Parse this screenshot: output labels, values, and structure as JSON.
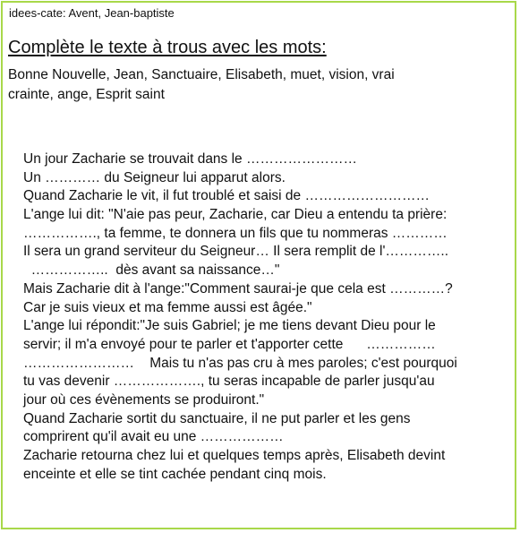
{
  "header": {
    "label": "idees-cate: Avent, Jean-baptiste"
  },
  "exercise": {
    "title": "Complète le texte à trous avec les mots:",
    "wordbank_line1": "Bonne Nouvelle,  Jean,  Sanctuaire,  Elisabeth,  muet,  vision,  vrai",
    "wordbank_line2": "crainte,  ange,  Esprit saint"
  },
  "story": {
    "lines": [
      "Un jour Zacharie se trouvait dans le ……………………",
      "Un ………… du Seigneur lui apparut alors.",
      "Quand Zacharie le vit, il fut troublé et saisi de ………………………",
      "L'ange lui dit: \"N'aie pas peur, Zacharie, car Dieu a entendu ta prière:",
      "……………., ta femme, te donnera un fils que tu nommeras …………",
      "Il sera un grand serviteur du Seigneur… Il sera remplit de l'…………..",
      "  ……………..  dès avant sa naissance…\"",
      "Mais Zacharie dit à l'ange:\"Comment saurai-je que cela est …………?",
      "Car je suis vieux et ma femme aussi est âgée.\"",
      "L'ange lui répondit:\"Je suis Gabriel; je me tiens devant Dieu pour le",
      "servir; il m'a envoyé pour te parler et t'apporter cette      ……………",
      "……………………    Mais tu n'as pas cru à mes paroles; c'est pourquoi",
      "tu vas devenir ………………., tu seras incapable de parler jusqu'au",
      "jour où ces évènements se produiront.\"",
      "Quand Zacharie sortit du sanctuaire, il ne put parler et les gens",
      "comprirent qu'il avait eu une ………………",
      "Zacharie retourna chez lui et quelques temps après, Elisabeth devint",
      "enceinte et elle se tint cachée pendant cinq mois."
    ]
  }
}
